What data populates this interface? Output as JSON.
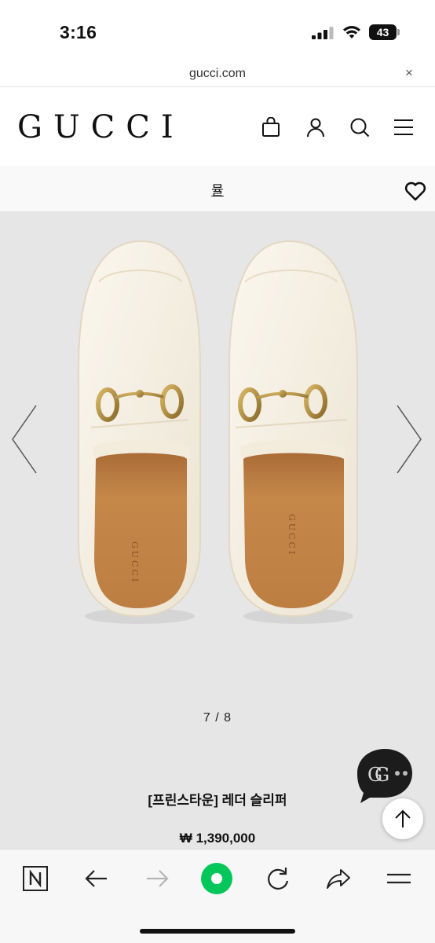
{
  "status_bar": {
    "time": "3:16",
    "battery": "43",
    "icons": [
      "signal-icon",
      "wifi-icon",
      "battery-icon"
    ]
  },
  "browser": {
    "url": "gucci.com",
    "close_label": "×"
  },
  "site_header": {
    "logo": "GUCCI",
    "icons": [
      "shopping-bag-icon",
      "account-icon",
      "search-icon",
      "menu-icon"
    ]
  },
  "sub_header": {
    "title": "뮬",
    "wishlist_icon": "heart-icon"
  },
  "gallery": {
    "counter": "7 / 8",
    "current_image": 7,
    "total_images": 8,
    "nav_icons": [
      "chevron-left-icon",
      "chevron-right-icon"
    ]
  },
  "product": {
    "name": "[프린스타운] 레더 슬리퍼",
    "price": "₩ 1,390,000"
  },
  "floating": {
    "chat_icon": "gg-chat-icon",
    "top_icon": "arrow-up-icon"
  },
  "toolbar": {
    "items": [
      "naver-n-icon",
      "back-icon",
      "forward-icon",
      "green-dot-icon",
      "refresh-icon",
      "share-icon",
      "menu-lines-icon"
    ],
    "accent": "#03c75a"
  }
}
